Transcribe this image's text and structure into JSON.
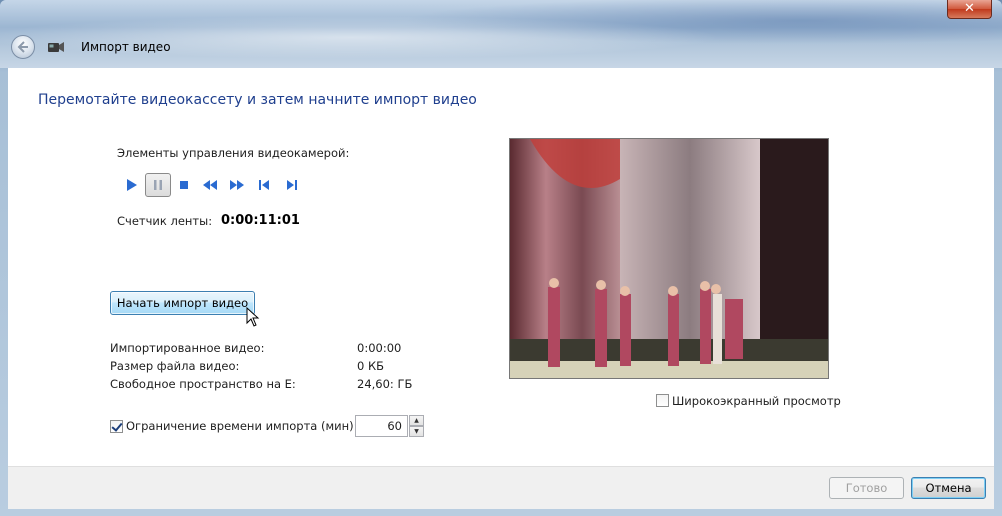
{
  "window": {
    "title": "Импорт видео",
    "close_glyph": "✕"
  },
  "main": {
    "heading": "Перемотайте видеокассету и затем начните импорт видео",
    "camera_controls_label": "Элементы управления видеокамерой:",
    "camera_controls": [
      {
        "name": "play-icon"
      },
      {
        "name": "pause-icon",
        "pressed": true
      },
      {
        "name": "stop-icon"
      },
      {
        "name": "rewind-icon"
      },
      {
        "name": "fast-forward-icon"
      },
      {
        "name": "step-back-icon"
      },
      {
        "name": "step-forward-icon"
      }
    ],
    "tape_counter_label": "Счетчик ленты:",
    "tape_counter_value": "0:00:11:01",
    "start_import_label": "Начать импорт видео",
    "stats": {
      "imported_label": "Импортированное видео:",
      "imported_value": "0:00:00",
      "size_label": "Размер файла видео:",
      "size_value": "0 КБ",
      "free_label": "Свободное пространство на E:",
      "free_value": "24,60: ГБ"
    },
    "time_limit": {
      "label": "Ограничение времени импорта (мин):",
      "checked": true,
      "value": "60"
    },
    "widescreen_label": "Широкоэкранный просмотр",
    "widescreen_checked": false
  },
  "footer": {
    "done_label": "Готово",
    "cancel_label": "Отмена"
  },
  "colors": {
    "heading": "#1f3f8e",
    "control_blue": "#2a6bd1"
  }
}
